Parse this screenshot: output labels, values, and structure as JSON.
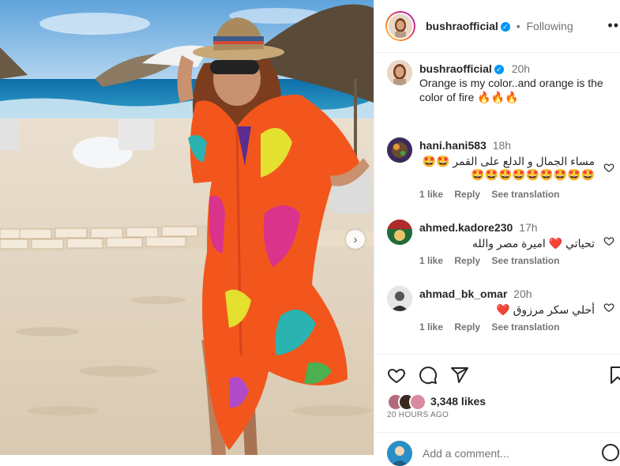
{
  "post": {
    "username": "bushraofficial",
    "follow_status": "Following",
    "separator": "•",
    "more": "••",
    "caption_time": "20h",
    "caption_line1": "Orange is my color..and orange is the",
    "caption_line2": "color of fire 🔥🔥🔥"
  },
  "comments": [
    {
      "username": "hani.hani583",
      "time": "18h",
      "text_line1": "مساء الجمال و الدلع على القمر 🤩🤩",
      "text_line2": "🤩🤩🤩🤩🤩🤩🤩🤩🤩",
      "likes": "1 like",
      "reply": "Reply",
      "translate": "See translation"
    },
    {
      "username": "ahmed.kadore230",
      "time": "17h",
      "text_line1": "تحياتي ❤️ اميرة مصر والله",
      "likes": "1 like",
      "reply": "Reply",
      "translate": "See translation"
    },
    {
      "username": "ahmad_bk_omar",
      "time": "20h",
      "text_line1": "أحلي سكر مرزوق ❤️",
      "likes": "1 like",
      "reply": "Reply",
      "translate": "See translation"
    }
  ],
  "footer": {
    "likes": "3,348 likes",
    "time": "20 HOURS AGO",
    "add_comment_placeholder": "Add a comment..."
  },
  "icons": {
    "like": "heart-icon",
    "comment": "comment-icon",
    "share": "paper-plane-icon",
    "save": "bookmark-icon",
    "emoji": "emoji-icon",
    "next": "chevron-right-icon",
    "verified": "verified-badge-icon"
  },
  "colors": {
    "accent": "#0095f6",
    "text": "#262626",
    "muted": "#737373",
    "like_red": "#ed4956",
    "dress": "#f2561d"
  }
}
